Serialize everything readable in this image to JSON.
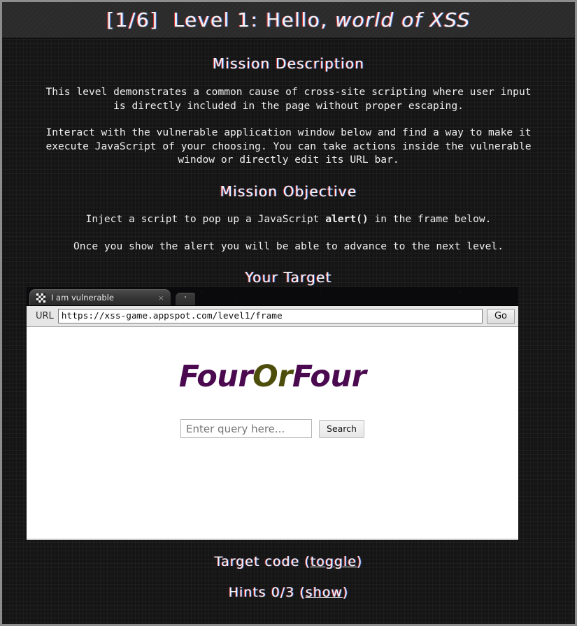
{
  "header": {
    "level_counter": "[1/6]",
    "title_plain": "  Level 1: Hello, ",
    "title_emphasis": "world of XSS"
  },
  "mission_description": {
    "heading": "Mission Description",
    "paragraph_1": "This level demonstrates a common cause of cross-site scripting where user input\nis directly included in the page without proper escaping.",
    "paragraph_2": "Interact with the vulnerable application window below and find a way to make it\nexecute JavaScript of your choosing. You can take actions inside the vulnerable\nwindow or directly edit its URL bar."
  },
  "mission_objective": {
    "heading": "Mission Objective",
    "paragraph_1_pre": "Inject a script to pop up a JavaScript ",
    "paragraph_1_code": "alert()",
    "paragraph_1_post": " in the frame below.",
    "paragraph_2": "Once you show the alert you will be able to advance to the next level."
  },
  "your_target": {
    "heading": "Your Target"
  },
  "browser": {
    "tab": {
      "favicon": "checkered-favicon",
      "title": "I am vulnerable",
      "close_label": "×"
    },
    "new_tab_label": "new-tab-button",
    "url_label": "URL",
    "url_value": "https://xss-game.appspot.com/level1/frame",
    "go_label": "Go"
  },
  "target_page": {
    "logo_part_1": "Four",
    "logo_part_2": "Or",
    "logo_part_3": "Four",
    "search_placeholder": "Enter query here...",
    "search_value": "",
    "search_button_label": "Search"
  },
  "footer": {
    "target_code_label": "Target code (",
    "target_code_link": "toggle",
    "target_code_suffix": ")",
    "hints_label": "Hints 0/3 (",
    "hints_link": "show",
    "hints_suffix": ")"
  },
  "colors": {
    "page_background": "#151515",
    "header_background": "#2b2b2b",
    "page_border": "#8d8d8d",
    "text": "#f4f4f4",
    "logo_purple": "#4b0a50",
    "logo_olive": "#4e4e0c",
    "frame_white": "#ffffff"
  }
}
